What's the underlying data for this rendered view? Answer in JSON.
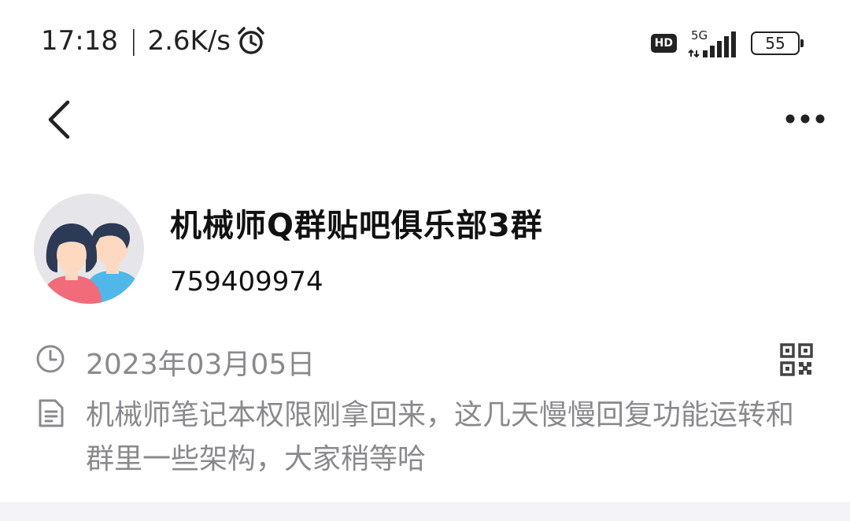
{
  "status_bar": {
    "time": "17:18",
    "separator": "|",
    "net_speed": "2.6K/s",
    "alarm_icon": "alarm-clock-icon",
    "hd_label": "HD",
    "network_type": "5G",
    "battery_level": "55"
  },
  "nav": {
    "back_icon": "chevron-left-icon",
    "more_icon": "more-dots-icon"
  },
  "profile": {
    "group_name": "机械师Q群贴吧俱乐部3群",
    "group_number": "759409974",
    "avatar_icon": "group-avatar-icon"
  },
  "info": {
    "created_date": "2023年03月05日",
    "description": "机械师笔记本权限刚拿回来，这几天慢慢回复功能运转和群里一些架构，大家稍等哈",
    "clock_icon": "clock-icon",
    "qr_icon": "qr-code-icon",
    "doc_icon": "document-icon"
  },
  "colors": {
    "primary_text": "#111111",
    "secondary_text": "#8a8a8e",
    "avatar_bg": "#e6e6ea",
    "avatar_female_shirt": "#f26b7a",
    "avatar_male_shirt": "#4fb8e8",
    "avatar_hair": "#2d3a55",
    "avatar_skin": "#fcd9c0"
  }
}
